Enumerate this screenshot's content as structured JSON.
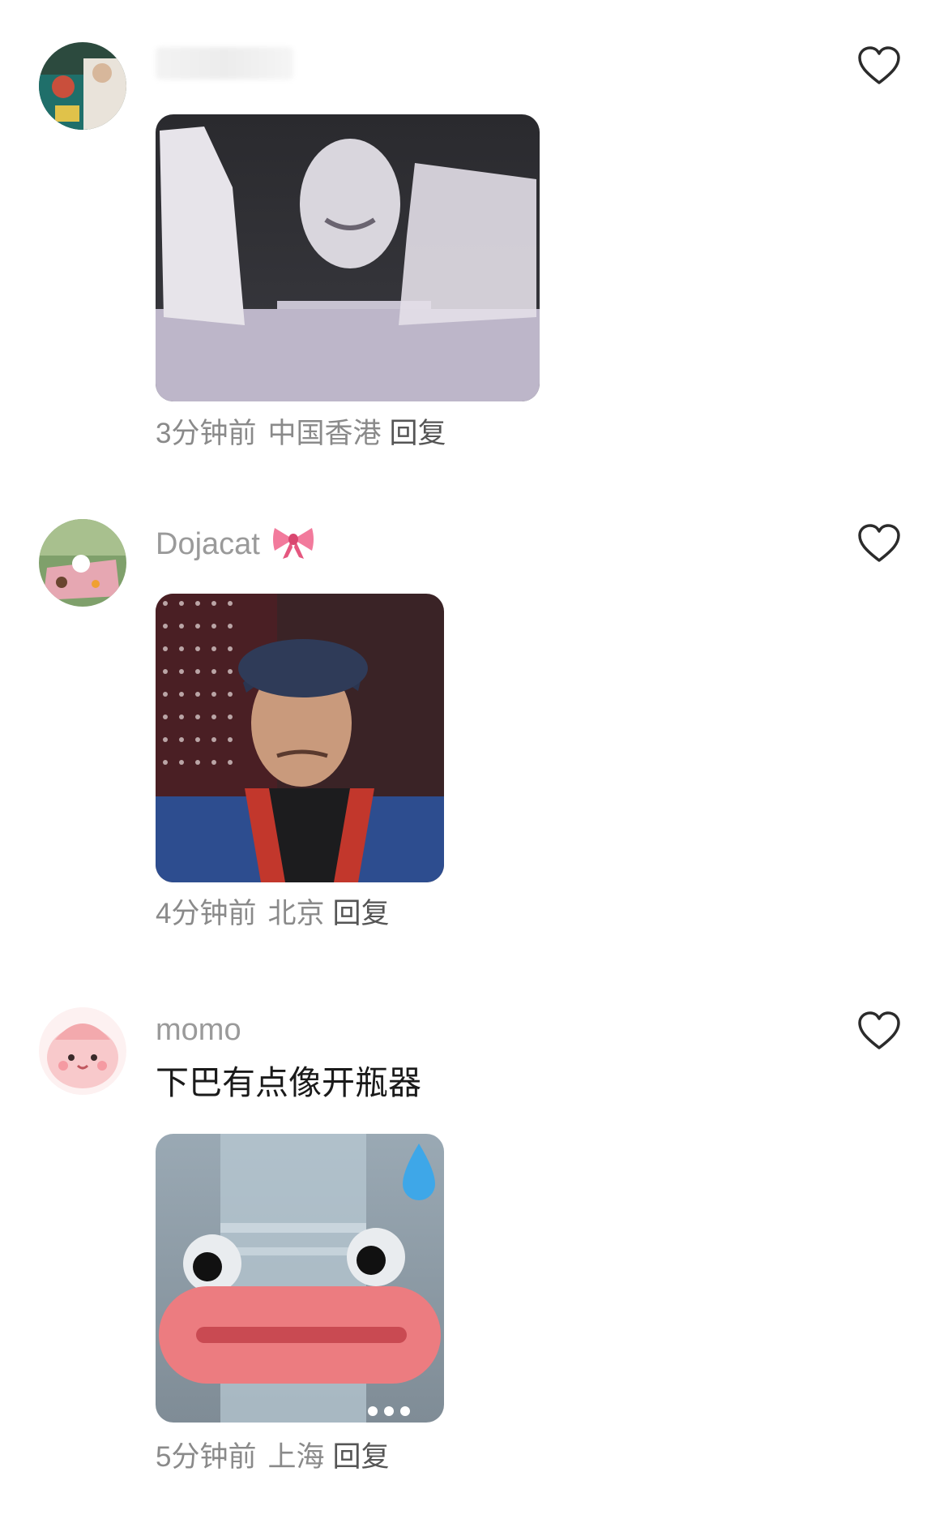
{
  "comments": [
    {
      "username": "",
      "time": "3分钟前",
      "location": "中国香港",
      "reply": "回复"
    },
    {
      "username": "Dojacat",
      "username_emoji": "bow-emoji",
      "time": "4分钟前",
      "location": "北京",
      "reply": "回复"
    },
    {
      "username": "momo",
      "text": "下巴有点像开瓶器",
      "time": "5分钟前",
      "location": "上海",
      "reply": "回复"
    }
  ],
  "icons": {
    "like": "heart-outline-icon"
  },
  "colors": {
    "meta": "#8a8a8a",
    "username": "#9a9a9a",
    "text": "#1a1a1a"
  }
}
